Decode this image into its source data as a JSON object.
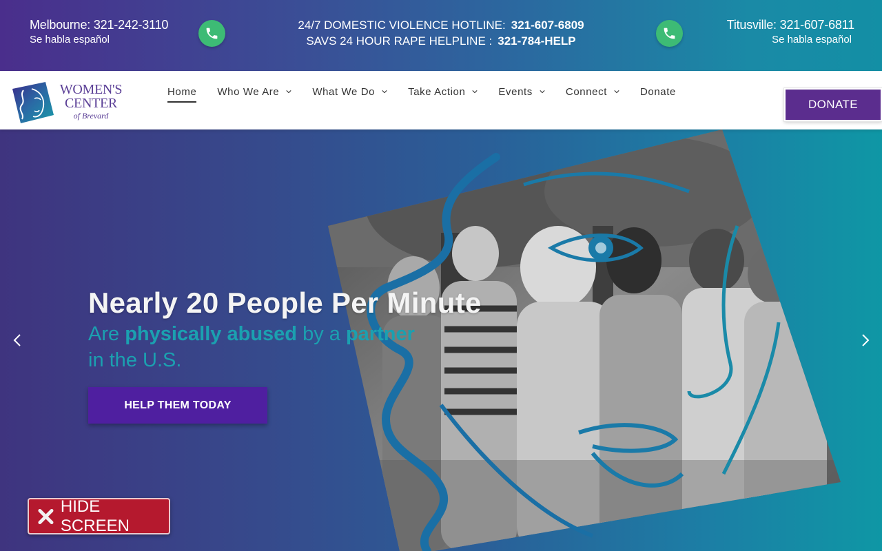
{
  "topbar": {
    "melbourne": {
      "phone": "Melbourne: 321-242-3110",
      "sub": "Se habla español"
    },
    "titusville": {
      "phone": "Titusville: 321-607-6811",
      "sub": "Se habla español"
    },
    "hotline": {
      "label": "24/7 DOMESTIC VIOLENCE HOTLINE:",
      "number": "321-607-6809"
    },
    "helpline": {
      "label": "SAVS 24 HOUR RAPE HELPLINE :",
      "number": "321-784-HELP"
    },
    "call_icon": "phone-icon",
    "call_color": "#3dbb75"
  },
  "logo": {
    "line1": "WOMEN'S",
    "line2": "CENTER",
    "line3": "of Brevard"
  },
  "nav": {
    "items": [
      {
        "label": "Home",
        "active": true,
        "dropdown": false
      },
      {
        "label": "Who We Are",
        "dropdown": true
      },
      {
        "label": "What We Do",
        "dropdown": true
      },
      {
        "label": "Take Action",
        "dropdown": true
      },
      {
        "label": "Events",
        "dropdown": true
      },
      {
        "label": "Connect",
        "dropdown": true
      },
      {
        "label": "Donate",
        "dropdown": false
      }
    ],
    "donate_button": "DONATE",
    "accent": "#5b2d8e"
  },
  "hero": {
    "title": "Nearly 20 People Per Minute",
    "sub_pre": "Are ",
    "sub_b1": "physically abused",
    "sub_mid": " by a ",
    "sub_b2": "partner",
    "sub_line2": "in the U.S.",
    "cta": "HELP THEM TODAY",
    "prev_icon": "chevron-left-icon",
    "next_icon": "chevron-right-icon",
    "text_accent": "#1ba0b0",
    "cta_color": "#4f1fa0"
  },
  "hide_screen": {
    "label": "HIDE SCREEN",
    "icon": "close-icon",
    "color": "#b5192e"
  }
}
